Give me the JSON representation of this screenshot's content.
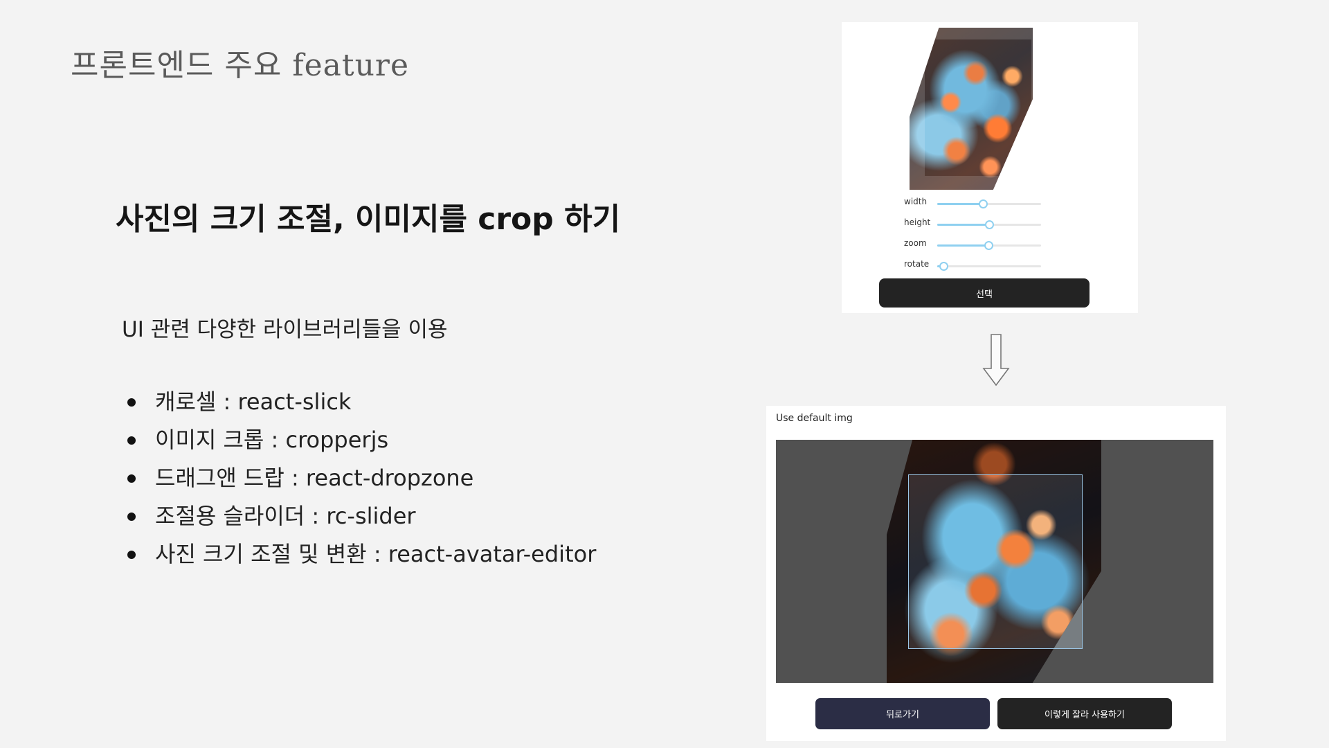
{
  "slide": {
    "title": "프론트엔드 주요 feature",
    "heading": "사진의 크기 조절, 이미지를 crop 하기",
    "intro": "UI 관련 다양한 라이브러리들을 이용",
    "features": [
      "캐로셀 : react-slick",
      "이미지 크롭 : cropperjs",
      "드래그앤 드랍 : react-dropzone",
      "조절용 슬라이더 : rc-slider",
      "사진 크기 조절 및 변환 : react-avatar-editor"
    ]
  },
  "editor": {
    "sliders": [
      {
        "label": "width",
        "value": 0.44
      },
      {
        "label": "height",
        "value": 0.5
      },
      {
        "label": "zoom",
        "value": 0.49
      },
      {
        "label": "rotate",
        "value": 0.06
      }
    ],
    "select_label": "선택"
  },
  "crop": {
    "caption": "Use default img",
    "back_label": "뒤로가기",
    "use_label": "이렇게 잘라 사용하기"
  },
  "colors": {
    "slider_accent": "#8fd0f0",
    "back_button": "#2b2d45",
    "dark_button": "#232323"
  }
}
